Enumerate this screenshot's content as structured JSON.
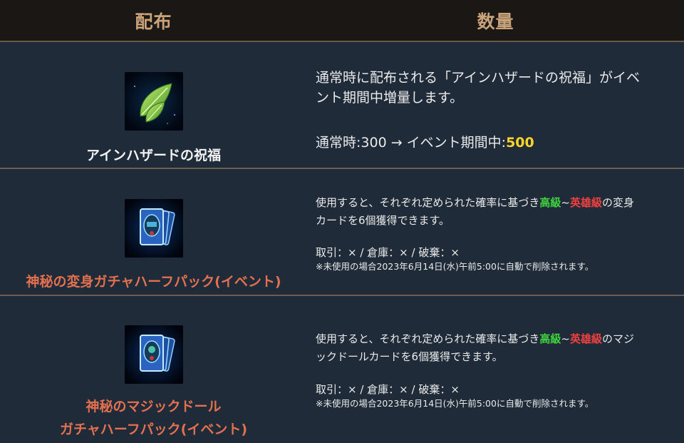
{
  "header": {
    "distribution": "配布",
    "quantity": "数量"
  },
  "rows": [
    {
      "name": "アインハザードの祝福",
      "icon": "leaf-icon",
      "desc_line1": "通常時に配布される「アインハザードの祝福」がイベ",
      "desc_line2": "ント期間中増量します。",
      "normal_label": "通常時:300 → イベント期間中:",
      "event_value": "500"
    },
    {
      "name": "神秘の変身ガチャハーフパック(イベント)",
      "icon": "transform-card-pack-icon",
      "desc_a": "使用すると、それぞれ定められた確率に基づき",
      "grade_high": "高級",
      "tilde": "~",
      "grade_hero": "英雄級",
      "desc_b": "の変身",
      "desc_line2": "カードを6個獲得できます。",
      "trade": "取引：× / 倉庫：× / 破棄：×",
      "note": "※未使用の場合2023年6月14日(水)午前5:00に自動で削除されます。"
    },
    {
      "name_line1": "神秘のマジックドール",
      "name_line2": "ガチャハーフパック(イベント)",
      "icon": "magic-doll-card-pack-icon",
      "desc_a": "使用すると、それぞれ定められた確率に基づき",
      "grade_high": "高級",
      "tilde": "~",
      "grade_hero": "英雄級",
      "desc_b": "のマジ",
      "desc_line2": "ックドールカードを6個獲得できます。",
      "trade": "取引：× / 倉庫：× / 破棄：×",
      "note": "※未使用の場合2023年6月14日(水)午前5:00に自動で削除されます。"
    }
  ],
  "colors": {
    "header_bg": "#1b1714",
    "header_text": "#c9a37a",
    "row_bg": "#1f2b38",
    "green": "#3fd43f",
    "red": "#f04040",
    "yellow": "#ffd42a",
    "orange_name": "#e3704f"
  }
}
